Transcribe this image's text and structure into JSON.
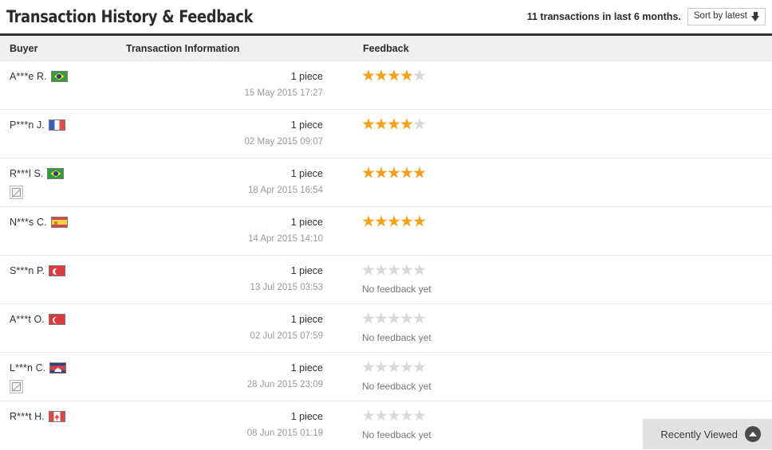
{
  "header": {
    "title": "Transaction History & Feedback",
    "transaction_count_text": "11 transactions in last 6 months.",
    "sort_label": "Sort by latest",
    "sort_icon": "arrow-down-icon"
  },
  "table": {
    "columns": {
      "buyer": "Buyer",
      "transaction": "Transaction Information",
      "feedback": "Feedback"
    },
    "no_feedback_text": "No feedback yet",
    "rows": [
      {
        "buyer": "A***e R.",
        "flag": "br",
        "flag_name": "flag-brazil-icon",
        "broken_image": false,
        "quantity": "1 piece",
        "date": "15 May 2015 17:27",
        "rating": 4,
        "has_feedback": true
      },
      {
        "buyer": "P***n J.",
        "flag": "fr",
        "flag_name": "flag-france-icon",
        "broken_image": false,
        "quantity": "1 piece",
        "date": "02 May 2015 09:07",
        "rating": 4,
        "has_feedback": true
      },
      {
        "buyer": "R***l S.",
        "flag": "br",
        "flag_name": "flag-brazil-icon",
        "broken_image": true,
        "quantity": "1 piece",
        "date": "18 Apr 2015 16:54",
        "rating": 5,
        "has_feedback": true
      },
      {
        "buyer": "N***s C.",
        "flag": "es",
        "flag_name": "flag-spain-icon",
        "broken_image": false,
        "quantity": "1 piece",
        "date": "14 Apr 2015 14:10",
        "rating": 5,
        "has_feedback": true
      },
      {
        "buyer": "S***n P.",
        "flag": "tr",
        "flag_name": "flag-turkey-icon",
        "broken_image": false,
        "quantity": "1 piece",
        "date": "13 Jul 2015 03:53",
        "rating": 0,
        "has_feedback": false
      },
      {
        "buyer": "A***t O.",
        "flag": "tr",
        "flag_name": "flag-turkey-icon",
        "broken_image": false,
        "quantity": "1 piece",
        "date": "02 Jul 2015 07:59",
        "rating": 0,
        "has_feedback": false
      },
      {
        "buyer": "L***n C.",
        "flag": "kh",
        "flag_name": "flag-cambodia-icon",
        "broken_image": true,
        "quantity": "1 piece",
        "date": "28 Jun 2015 23:09",
        "rating": 0,
        "has_feedback": false
      },
      {
        "buyer": "R***t H.",
        "flag": "ca",
        "flag_name": "flag-canada-icon",
        "broken_image": false,
        "quantity": "1 piece",
        "date": "08 Jun 2015 01:19",
        "rating": 0,
        "has_feedback": false
      }
    ]
  },
  "recently_viewed": {
    "label": "Recently Viewed",
    "icon": "circle-chevron-up-icon"
  },
  "colors": {
    "star_filled": "#f5a11f",
    "star_empty": "#d9d9d9",
    "header_bg": "#f0f0f0",
    "top_border": "#333333",
    "muted_text": "#999999"
  }
}
